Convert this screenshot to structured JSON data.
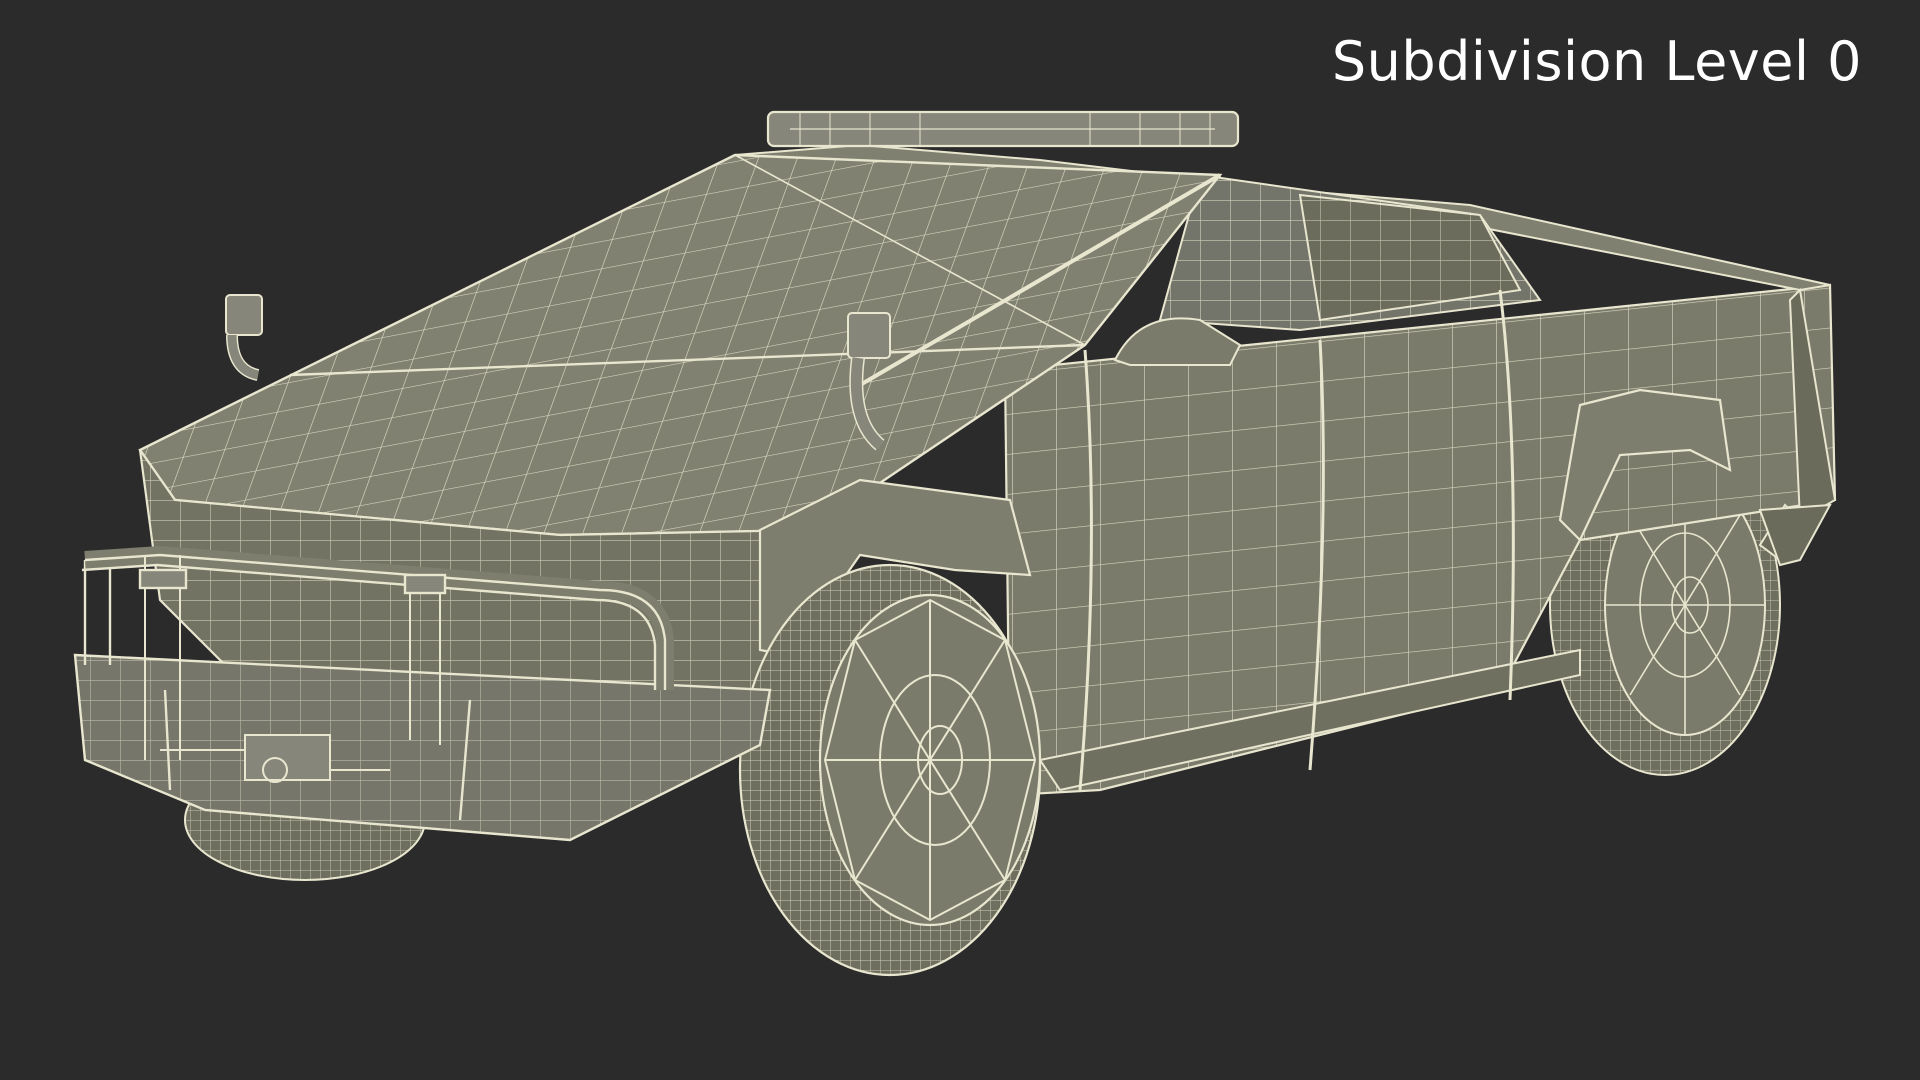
{
  "overlay": {
    "label": "Subdivision Level 0"
  },
  "colors": {
    "background": "#2b2b2b",
    "surface": "#7a7b6a",
    "surface_dark": "#6a6b5b",
    "surface_light": "#8a8b79",
    "wire": "#e8e6cf"
  }
}
